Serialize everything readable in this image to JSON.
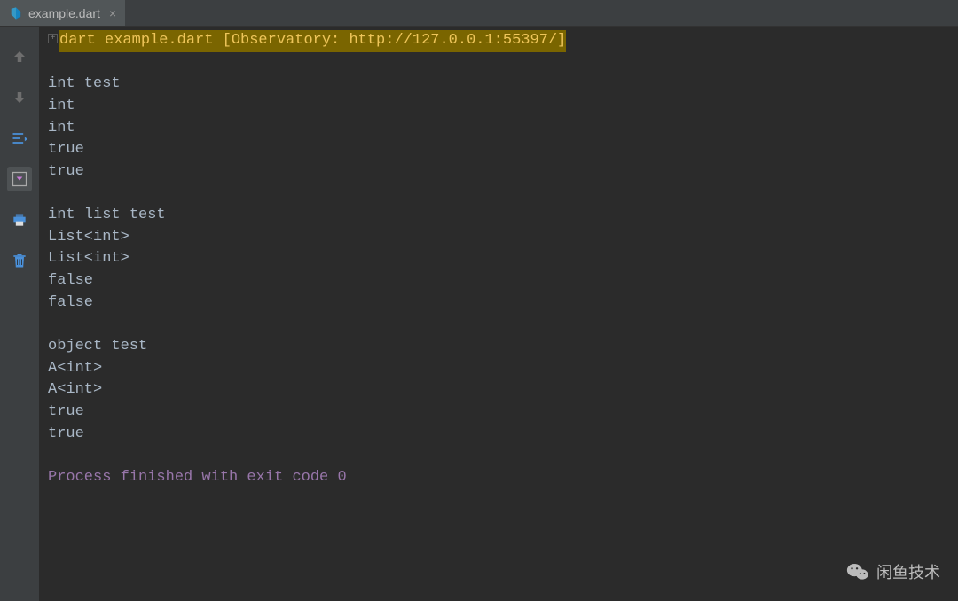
{
  "tab": {
    "filename": "example.dart"
  },
  "console": {
    "header": "dart example.dart [Observatory: http://127.0.0.1:55397/]",
    "output": [
      "",
      "int test",
      "int",
      "int",
      "true",
      "true",
      "",
      "int list test",
      "List<int>",
      "List<int>",
      "false",
      "false",
      "",
      "object test",
      "A<int>",
      "A<int>",
      "true",
      "true",
      ""
    ],
    "process_msg": "Process finished with exit code 0"
  },
  "watermark": {
    "text": "闲鱼技术"
  }
}
